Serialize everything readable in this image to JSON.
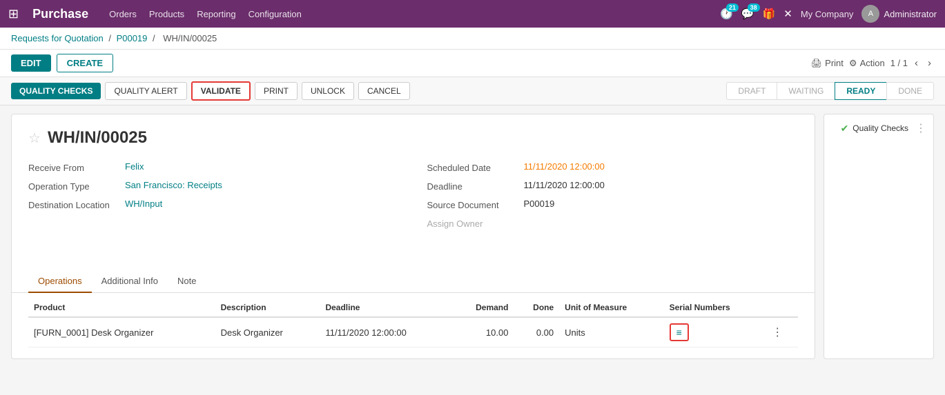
{
  "topnav": {
    "apps_icon": "⊞",
    "brand": "Purchase",
    "menu": [
      {
        "label": "Orders",
        "id": "orders"
      },
      {
        "label": "Products",
        "id": "products"
      },
      {
        "label": "Reporting",
        "id": "reporting"
      },
      {
        "label": "Configuration",
        "id": "configuration"
      }
    ],
    "notif1_count": "21",
    "notif2_count": "38",
    "company": "My Company",
    "user": "Administrator"
  },
  "breadcrumb": {
    "parts": [
      {
        "label": "Requests for Quotation",
        "link": true
      },
      {
        "label": "P00019",
        "link": true
      },
      {
        "label": "WH/IN/00025",
        "link": false
      }
    ],
    "sep": "/"
  },
  "action_bar": {
    "edit_label": "EDIT",
    "create_label": "CREATE",
    "print_label": "Print",
    "action_label": "Action",
    "pager": "1 / 1"
  },
  "toolbar": {
    "quality_checks_label": "QUALITY CHECKS",
    "quality_alert_label": "QUALITY ALERT",
    "validate_label": "VALIDATE",
    "print_label": "PRINT",
    "unlock_label": "UNLOCK",
    "cancel_label": "CANCEL"
  },
  "status_bar": {
    "items": [
      {
        "label": "DRAFT",
        "active": false
      },
      {
        "label": "WAITING",
        "active": false
      },
      {
        "label": "READY",
        "active": true
      },
      {
        "label": "DONE",
        "active": false
      }
    ]
  },
  "quality_panel": {
    "icon": "✔",
    "label": "Quality Checks"
  },
  "form": {
    "title": "WH/IN/00025",
    "star": "☆",
    "fields_left": [
      {
        "label": "Receive From",
        "value": "Felix",
        "style": "link"
      },
      {
        "label": "Operation Type",
        "value": "San Francisco: Receipts",
        "style": "link"
      },
      {
        "label": "Destination Location",
        "value": "WH/Input",
        "style": "link"
      }
    ],
    "fields_right": [
      {
        "label": "Scheduled Date",
        "value": "11/11/2020 12:00:00",
        "style": "orange"
      },
      {
        "label": "Deadline",
        "value": "11/11/2020 12:00:00",
        "style": "black"
      },
      {
        "label": "Source Document",
        "value": "P00019",
        "style": "black"
      },
      {
        "label": "Assign Owner",
        "value": "",
        "style": "gray"
      }
    ]
  },
  "tabs": [
    {
      "label": "Operations",
      "active": true
    },
    {
      "label": "Additional Info",
      "active": false
    },
    {
      "label": "Note",
      "active": false
    }
  ],
  "table": {
    "columns": [
      {
        "label": "Product"
      },
      {
        "label": "Description"
      },
      {
        "label": "Deadline"
      },
      {
        "label": "Demand"
      },
      {
        "label": "Done"
      },
      {
        "label": "Unit of Measure"
      },
      {
        "label": "Serial Numbers"
      },
      {
        "label": ""
      }
    ],
    "rows": [
      {
        "product": "[FURN_0001] Desk Organizer",
        "description": "Desk Organizer",
        "deadline": "11/11/2020 12:00:00",
        "demand": "10.00",
        "done": "0.00",
        "uom": "Units",
        "serial_icon": "≡"
      }
    ]
  }
}
